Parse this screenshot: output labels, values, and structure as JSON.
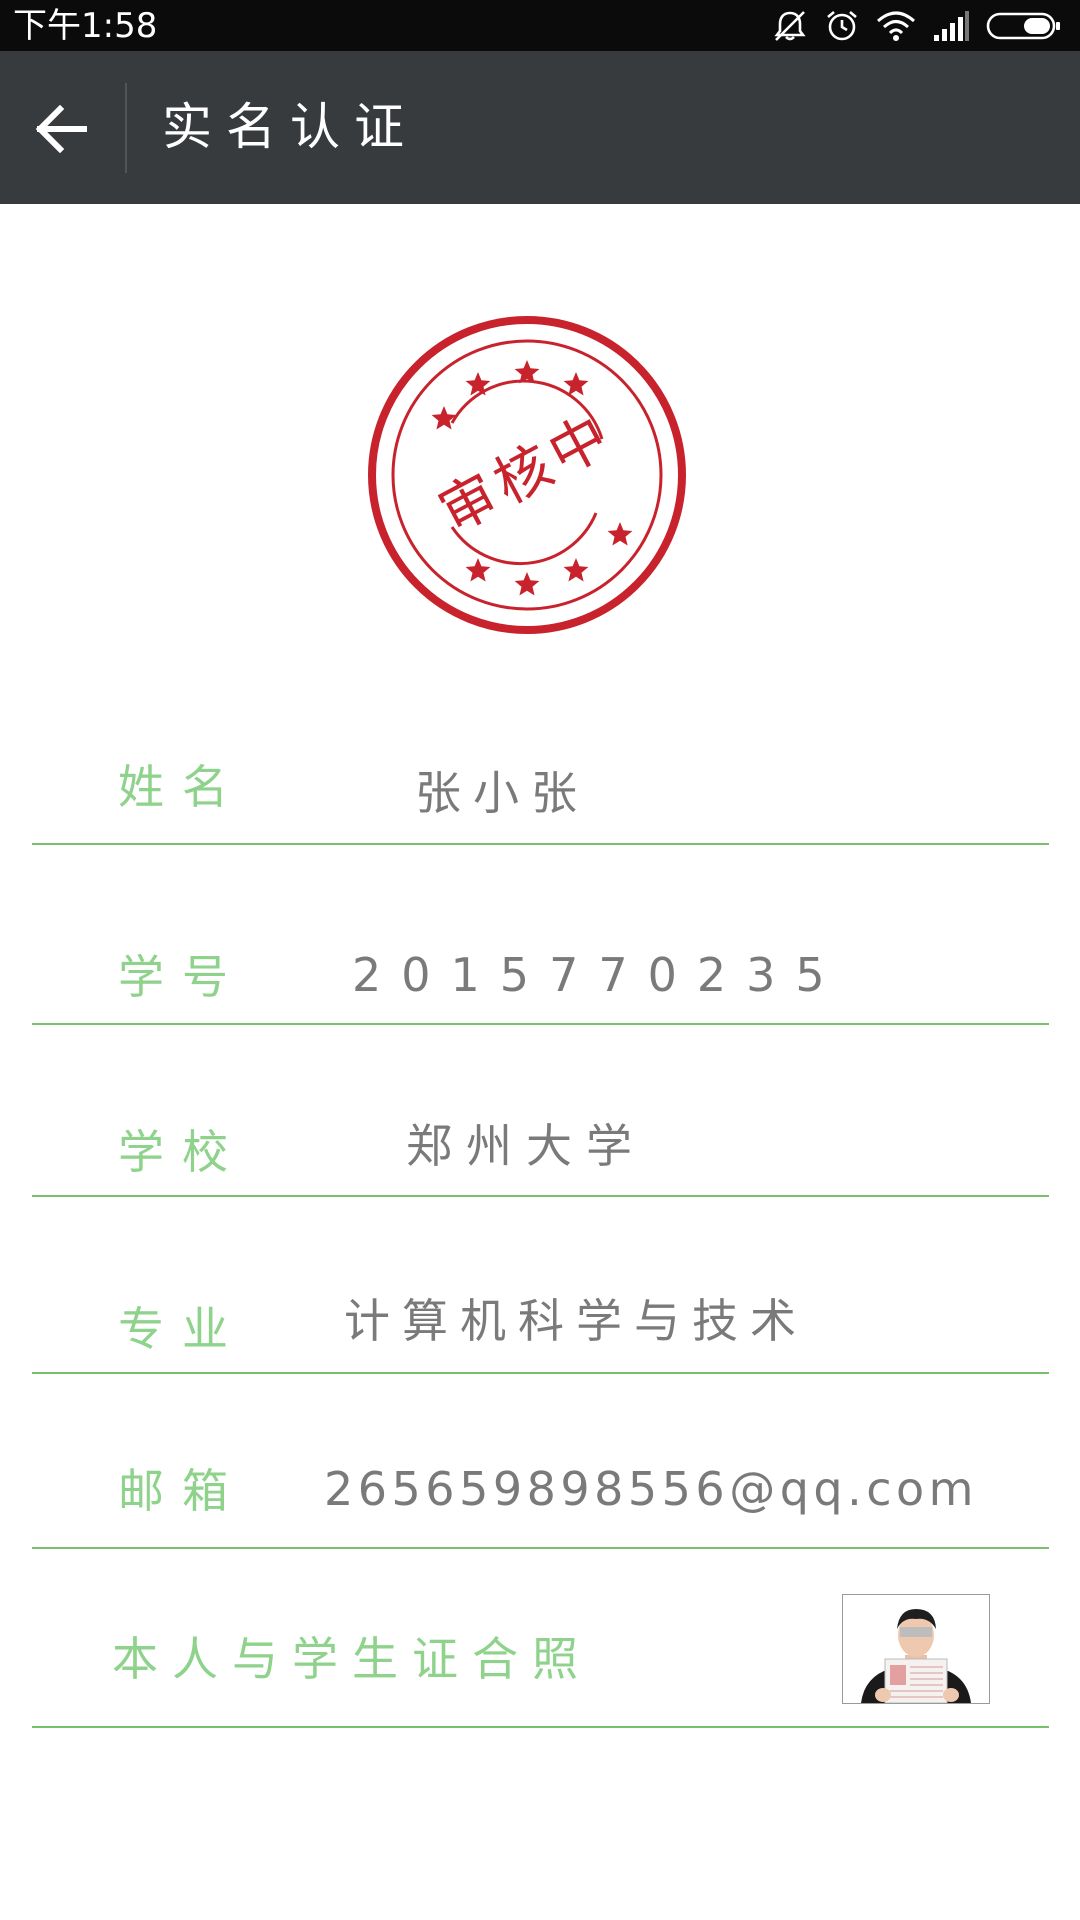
{
  "status_bar": {
    "time": "下午1:58",
    "icons": [
      "mute-icon",
      "alarm-icon",
      "wifi-icon",
      "signal-icon",
      "battery-icon"
    ]
  },
  "action_bar": {
    "title": "实名认证",
    "back_icon": "arrow-left-icon"
  },
  "stamp": {
    "text": "审核中",
    "color": "#c8232c"
  },
  "form": {
    "name": {
      "label": "姓名",
      "value": "张小张"
    },
    "student_id": {
      "label": "学号",
      "value": "2015770235"
    },
    "school": {
      "label": "学校",
      "value": "郑州大学"
    },
    "major": {
      "label": "专业",
      "value": "计算机科学与技术"
    },
    "email": {
      "label": "邮箱",
      "value": "265659898556@qq.com"
    },
    "photo": {
      "label": "本人与学生证合照"
    }
  },
  "colors": {
    "label_green": "#8ed28b",
    "line_green": "#7bc06a",
    "value_gray": "#7a7a7a",
    "action_bar_bg": "#373b3e",
    "status_bar_bg": "#0b0b0b"
  }
}
